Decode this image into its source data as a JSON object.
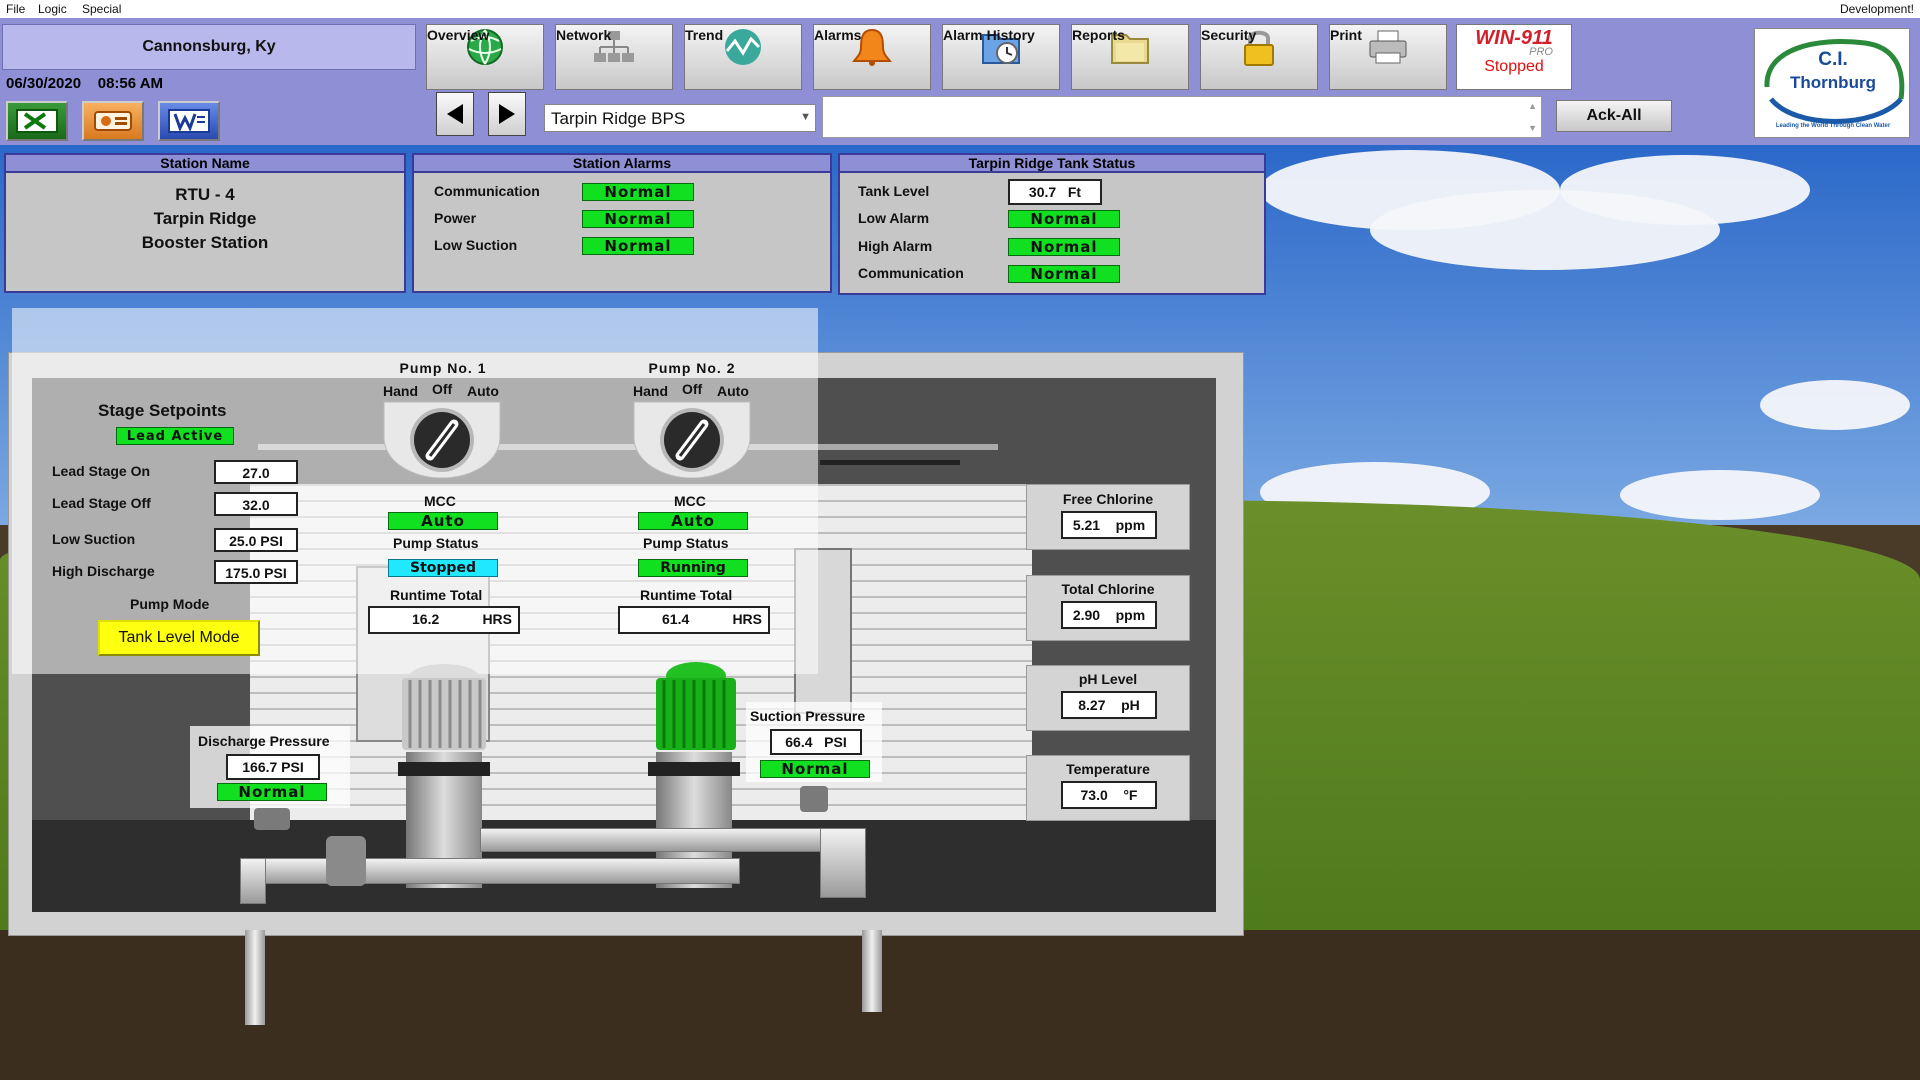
{
  "menu": [
    "File",
    "Logic",
    "Special"
  ],
  "menu_right": "Development!",
  "header": {
    "location": "Cannonsburg, Ky",
    "date": "06/30/2020",
    "time": "08:56 AM",
    "nav": [
      {
        "label": "Overview",
        "icon": "globe-icon"
      },
      {
        "label": "Network",
        "icon": "network-icon"
      },
      {
        "label": "Trend",
        "icon": "trend-icon"
      },
      {
        "label": "Alarms",
        "icon": "bell-icon"
      },
      {
        "label": "Alarm History",
        "icon": "clock-folder-icon"
      },
      {
        "label": "Reports",
        "icon": "folder-icon"
      },
      {
        "label": "Security",
        "icon": "lock-icon"
      },
      {
        "label": "Print",
        "icon": "printer-icon"
      }
    ],
    "win911": {
      "title": "WIN-911",
      "sub": "PRO",
      "status": "Stopped"
    },
    "station_select": "Tarpin Ridge BPS",
    "ack_all": "Ack-All",
    "logo": {
      "line1": "C.I.",
      "line2": "Thornburg",
      "tagline": "Leading the World Through Clean Water"
    }
  },
  "station_name": {
    "title": "Station Name",
    "lines": [
      "RTU - 4",
      "Tarpin Ridge",
      "Booster Station"
    ]
  },
  "station_alarms": {
    "title": "Station Alarms",
    "rows": [
      {
        "label": "Communication",
        "value": "Normal"
      },
      {
        "label": "Power",
        "value": "Normal"
      },
      {
        "label": "Low Suction",
        "value": "Normal"
      }
    ]
  },
  "tank_status": {
    "title": "Tarpin Ridge Tank Status",
    "tank_level_label": "Tank Level",
    "tank_level_value": "30.7",
    "tank_level_unit": "Ft",
    "rows": [
      {
        "label": "Low Alarm",
        "value": "Normal"
      },
      {
        "label": "High Alarm",
        "value": "Normal"
      },
      {
        "label": "Communication",
        "value": "Normal"
      }
    ]
  },
  "setpoints": {
    "title": "Stage Setpoints",
    "badge": "Lead Active",
    "rows": [
      {
        "label": "Lead Stage On",
        "value": "27.0"
      },
      {
        "label": "Lead Stage Off",
        "value": "32.0"
      },
      {
        "label": "Low Suction",
        "value": "25.0 PSI"
      },
      {
        "label": "High Discharge",
        "value": "175.0 PSI"
      }
    ],
    "mode_label": "Pump Mode",
    "mode_button": "Tank Level Mode"
  },
  "pumps": [
    {
      "name": "Pump No. 1",
      "hand": "Hand",
      "off": "Off",
      "auto": "Auto",
      "mcc_label": "MCC",
      "mcc": "Auto",
      "status_label": "Pump Status",
      "status": "Stopped",
      "runtime_label": "Runtime Total",
      "runtime": "16.2",
      "runtime_unit": "HRS"
    },
    {
      "name": "Pump No. 2",
      "hand": "Hand",
      "off": "Off",
      "auto": "Auto",
      "mcc_label": "MCC",
      "mcc": "Auto",
      "status_label": "Pump Status",
      "status": "Running",
      "runtime_label": "Runtime Total",
      "runtime": "61.4",
      "runtime_unit": "HRS"
    }
  ],
  "discharge": {
    "label": "Discharge Pressure",
    "value": "166.7 PSI",
    "status": "Normal"
  },
  "suction": {
    "label": "Suction Pressure",
    "value": "66.4",
    "unit": "PSI",
    "status": "Normal"
  },
  "analyzers": [
    {
      "label": "Free Chlorine",
      "value": "5.21",
      "unit": "ppm"
    },
    {
      "label": "Total Chlorine",
      "value": "2.90",
      "unit": "ppm"
    },
    {
      "label": "pH Level",
      "value": "8.27",
      "unit": "pH"
    },
    {
      "label": "Temperature",
      "value": "73.0",
      "unit": "°F"
    }
  ],
  "colors": {
    "normal": "#10e020",
    "stopped": "#20e8ff",
    "running": "#10e020",
    "mode": "#ffff10",
    "header": "#8f8fd6"
  }
}
